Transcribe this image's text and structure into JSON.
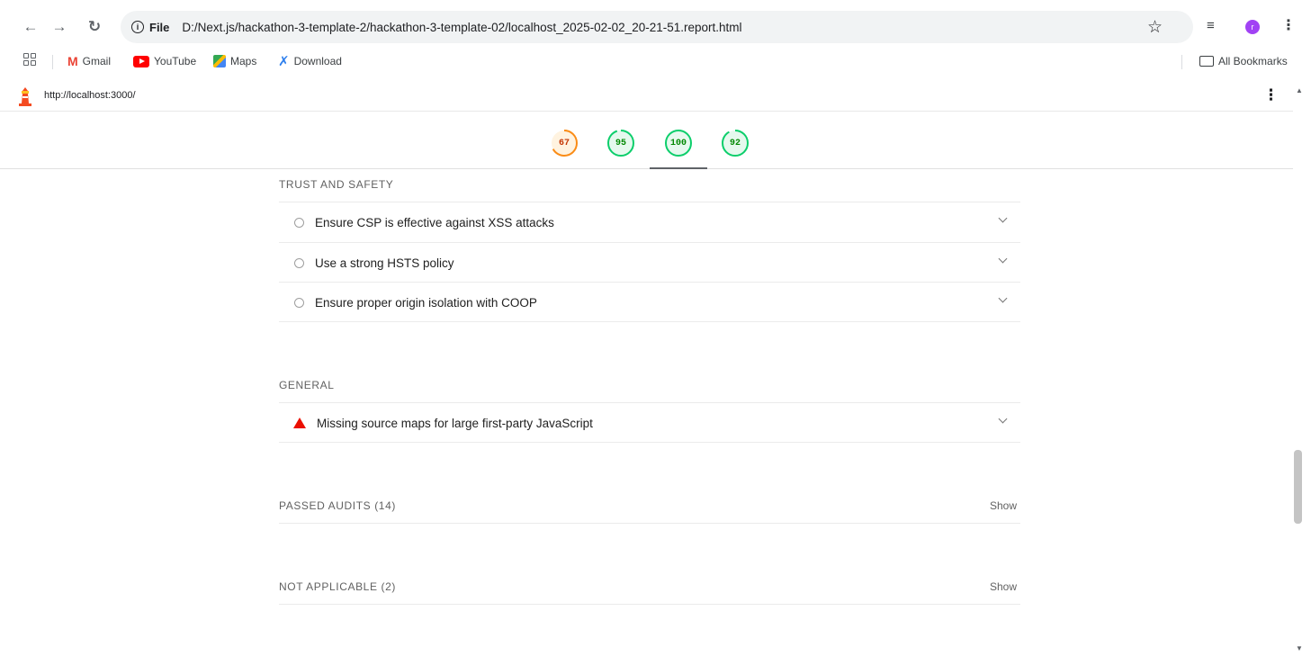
{
  "browser": {
    "scheme_label": "File",
    "url": "D:/Next.js/hackathon-3-template-2/hackathon-3-template-02/localhost_2025-02-02_20-21-51.report.html",
    "avatar_letter": "r",
    "nav_icons": [
      "back-arrow-icon",
      "forward-arrow-icon",
      "reload-icon"
    ]
  },
  "bookmarks": {
    "items": [
      {
        "label": "Gmail",
        "icon": "gmail-icon"
      },
      {
        "label": "YouTube",
        "icon": "youtube-icon"
      },
      {
        "label": "Maps",
        "icon": "maps-icon"
      },
      {
        "label": "Download",
        "icon": "vscode-icon"
      }
    ],
    "all_bookmarks": "All Bookmarks"
  },
  "report": {
    "page_url": "http://localhost:3000/",
    "scores": [
      {
        "value": "67",
        "score": 67,
        "color": "#fa8c16"
      },
      {
        "value": "95",
        "score": 95,
        "color": "#0cce6b"
      },
      {
        "value": "100",
        "score": 100,
        "color": "#0cce6b",
        "active": true
      },
      {
        "value": "92",
        "score": 92,
        "color": "#0cce6b"
      }
    ],
    "sections": {
      "trust": {
        "title": "TRUST AND SAFETY",
        "audits": [
          "Ensure CSP is effective against XSS attacks",
          "Use a strong HSTS policy",
          "Ensure proper origin isolation with COOP"
        ]
      },
      "general": {
        "title": "GENERAL",
        "audits": [
          "Missing source maps for large first-party JavaScript"
        ]
      },
      "passed": {
        "title": "PASSED AUDITS (14)",
        "action": "Show"
      },
      "not_applicable": {
        "title": "NOT APPLICABLE (2)",
        "action": "Show"
      }
    },
    "colors": {
      "warn": "#eb0f00",
      "pass": "#0cce6b",
      "average": "#fa8c16"
    }
  }
}
